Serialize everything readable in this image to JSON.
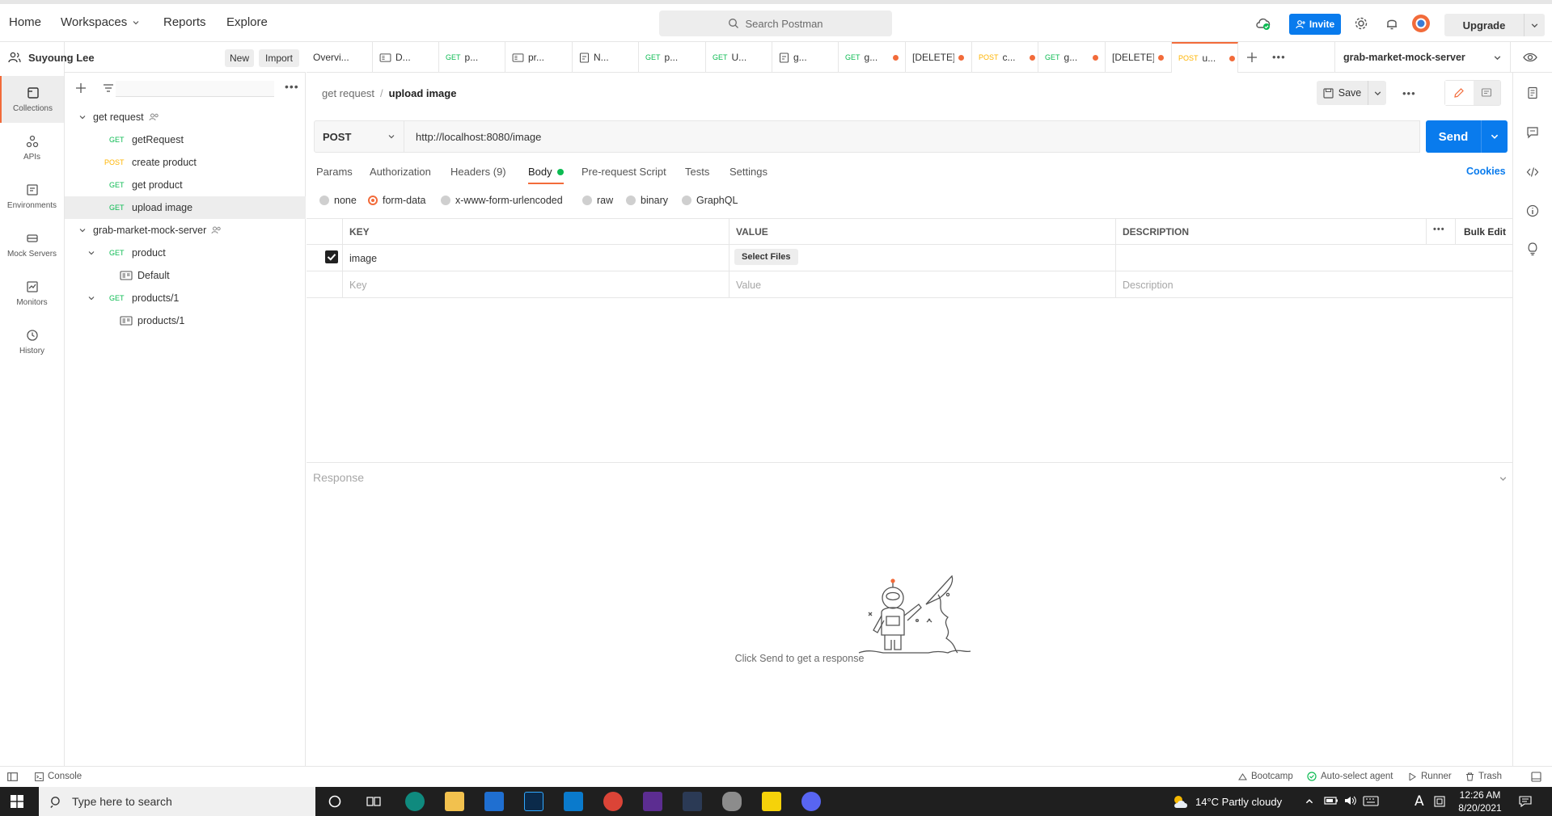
{
  "nav": {
    "home": "Home",
    "workspaces": "Workspaces",
    "reports": "Reports",
    "explore": "Explore",
    "search_placeholder": "Search Postman",
    "invite": "Invite",
    "upgrade": "Upgrade"
  },
  "workspace": {
    "user": "Suyoung Lee",
    "new_label": "New",
    "import_label": "Import"
  },
  "rail": [
    {
      "label": "Collections",
      "icon": "collections-icon"
    },
    {
      "label": "APIs",
      "icon": "apis-icon"
    },
    {
      "label": "Environments",
      "icon": "environments-icon"
    },
    {
      "label": "Mock Servers",
      "icon": "mock-servers-icon"
    },
    {
      "label": "Monitors",
      "icon": "monitors-icon"
    },
    {
      "label": "History",
      "icon": "history-icon"
    }
  ],
  "tree": [
    {
      "label": "get request",
      "method": ""
    },
    {
      "label": "getRequest",
      "method": "GET"
    },
    {
      "label": "create product",
      "method": "POST"
    },
    {
      "label": "get product",
      "method": "GET"
    },
    {
      "label": "upload image",
      "method": "GET"
    },
    {
      "label": "grab-market-mock-server",
      "method": ""
    },
    {
      "label": "product",
      "method": "GET"
    },
    {
      "label": "Default",
      "method": ""
    },
    {
      "label": "products/1",
      "method": "GET"
    },
    {
      "label": "products/1",
      "method": ""
    }
  ],
  "tabs": [
    {
      "method": "",
      "label": "Overvi..."
    },
    {
      "method": "",
      "label": "D..."
    },
    {
      "method": "GET",
      "label": "p..."
    },
    {
      "method": "",
      "label": "pr..."
    },
    {
      "method": "",
      "label": "N..."
    },
    {
      "method": "GET",
      "label": "p..."
    },
    {
      "method": "GET",
      "label": "U..."
    },
    {
      "method": "",
      "label": "g..."
    },
    {
      "method": "GET",
      "label": "g..."
    },
    {
      "method": "",
      "label": "[DELETE]"
    },
    {
      "method": "POST",
      "label": "c..."
    },
    {
      "method": "GET",
      "label": "g..."
    },
    {
      "method": "",
      "label": "[DELETE]"
    },
    {
      "method": "POST",
      "label": "u..."
    }
  ],
  "environment": "grab-market-mock-server",
  "request": {
    "breadcrumb_parent": "get request",
    "breadcrumb_sep": "/",
    "breadcrumb_current": "upload image",
    "save_label": "Save",
    "method": "POST",
    "url": "http://localhost:8080/image",
    "send_label": "Send",
    "tabs": {
      "params": "Params",
      "authorization": "Authorization",
      "headers": "Headers (9)",
      "body": "Body",
      "prerequest": "Pre-request Script",
      "tests": "Tests",
      "settings": "Settings"
    },
    "cookies": "Cookies",
    "body_types": [
      "none",
      "form-data",
      "x-www-form-urlencoded",
      "raw",
      "binary",
      "GraphQL"
    ],
    "body_selected": "form-data",
    "table": {
      "key_header": "KEY",
      "value_header": "VALUE",
      "description_header": "DESCRIPTION",
      "bulk_edit": "Bulk Edit",
      "row_key": "image",
      "row_value_button": "Select Files",
      "key_placeholder": "Key",
      "value_placeholder": "Value",
      "description_placeholder": "Description"
    }
  },
  "response": {
    "title": "Response",
    "empty_text": "Click Send to get a response"
  },
  "statusbar": {
    "console": "Console",
    "bootcamp": "Bootcamp",
    "auto_select": "Auto-select agent",
    "runner": "Runner",
    "trash": "Trash"
  },
  "taskbar": {
    "search_placeholder": "Type here to search",
    "weather": "14°C  Partly cloudy",
    "time": "12:26 AM",
    "date": "8/20/2021"
  },
  "colors": {
    "accent": "#f26b3a",
    "primary": "#097bed",
    "get": "#0cbb52",
    "post": "#ffb400",
    "body_dot": "#0cbb52"
  }
}
